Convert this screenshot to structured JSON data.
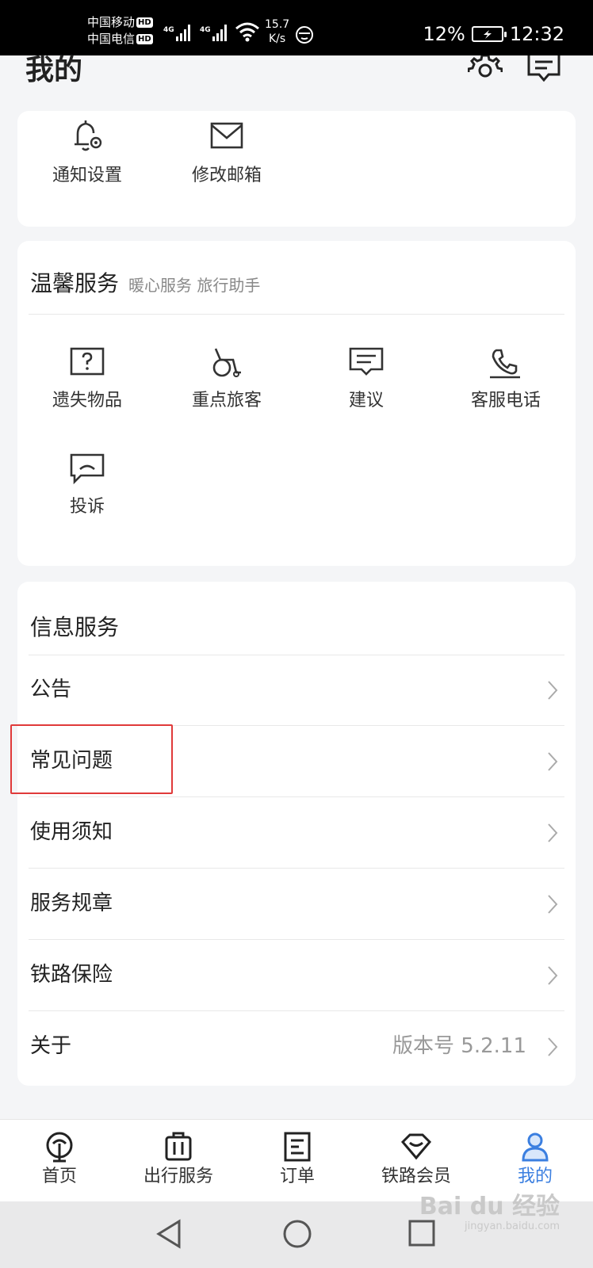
{
  "status_bar": {
    "carrier1": "中国移动",
    "carrier2": "中国电信",
    "hd": "HD",
    "net": "4G",
    "speed_value": "15.7",
    "speed_unit": "K/s",
    "battery": "12%",
    "time": "12:32"
  },
  "header": {
    "title": "我的",
    "icons": [
      "gear-icon",
      "message-icon"
    ]
  },
  "account_card": {
    "items": [
      {
        "label": "通知设置",
        "icon": "bell-gear-icon"
      },
      {
        "label": "修改邮箱",
        "icon": "envelope-icon"
      }
    ]
  },
  "warm_service": {
    "title": "温馨服务",
    "subtitle": "暖心服务 旅行助手",
    "items": [
      {
        "label": "遗失物品",
        "icon": "question-box-icon"
      },
      {
        "label": "重点旅客",
        "icon": "wheelchair-icon"
      },
      {
        "label": "建议",
        "icon": "comment-icon"
      },
      {
        "label": "客服电话",
        "icon": "phone-icon"
      },
      {
        "label": "投诉",
        "icon": "complaint-icon"
      }
    ]
  },
  "info_service": {
    "title": "信息服务",
    "rows": [
      {
        "label": "公告",
        "value": ""
      },
      {
        "label": "常见问题",
        "value": ""
      },
      {
        "label": "使用须知",
        "value": ""
      },
      {
        "label": "服务规章",
        "value": ""
      },
      {
        "label": "铁路保险",
        "value": ""
      },
      {
        "label": "关于",
        "value": "版本号 5.2.11"
      }
    ]
  },
  "bottom_nav": {
    "items": [
      {
        "label": "首页",
        "icon": "railway-logo-icon",
        "active": false
      },
      {
        "label": "出行服务",
        "icon": "luggage-icon",
        "active": false
      },
      {
        "label": "订单",
        "icon": "order-icon",
        "active": false
      },
      {
        "label": "铁路会员",
        "icon": "diamond-icon",
        "active": false
      },
      {
        "label": "我的",
        "icon": "user-icon",
        "active": true
      }
    ]
  },
  "colors": {
    "accent": "#3b7fe0",
    "highlight": "#e03a3a",
    "background": "#f4f5f7"
  },
  "watermark": {
    "main": "Bai du 经验",
    "sub": "jingyan.baidu.com"
  }
}
